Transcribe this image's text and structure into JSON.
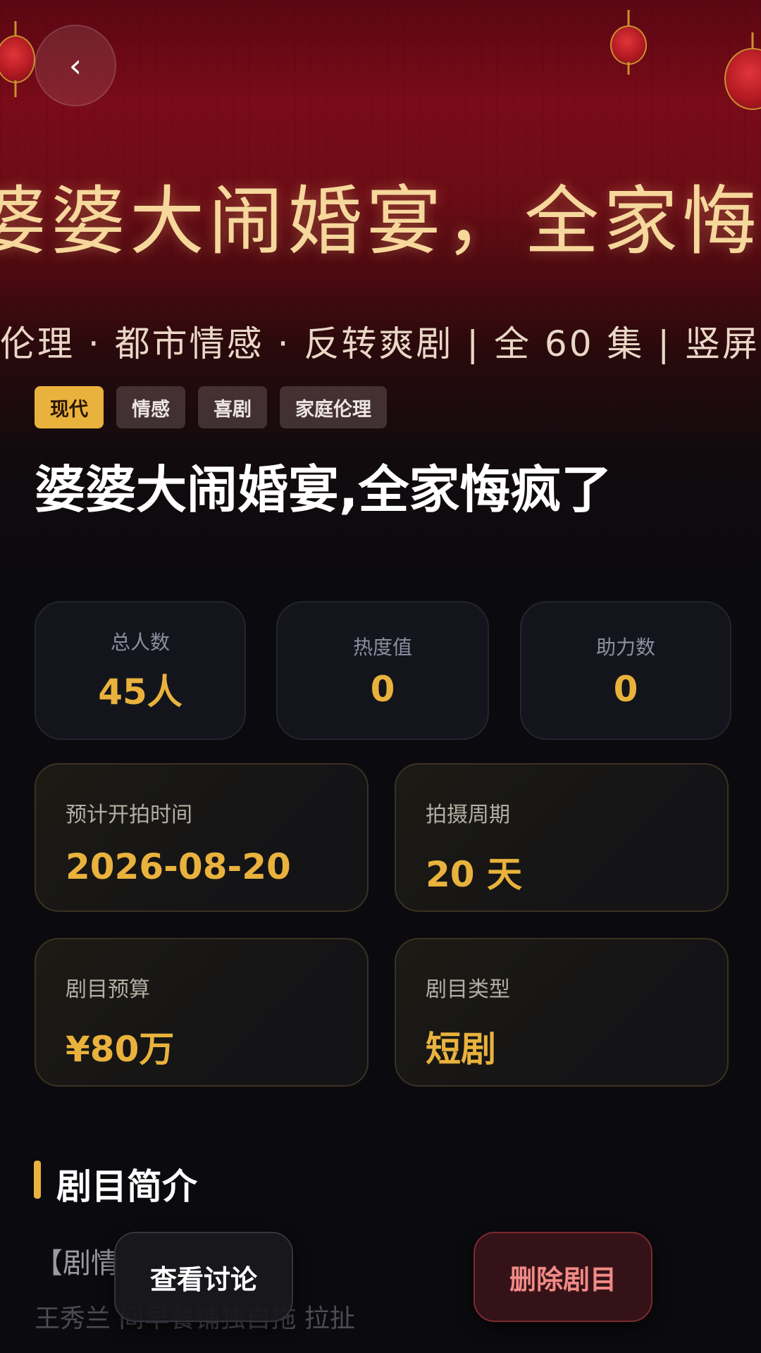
{
  "banner": {
    "title": "婆婆大闹婚宴，全家悔疯了",
    "subtitle": "伦理 ·  都市情感 ·  反转爽剧 | 全 60 集 | 竖屏"
  },
  "nav": {
    "back_icon": "chevron-left-icon",
    "back_glyph": "‹"
  },
  "tags": [
    "现代",
    "情感",
    "喜剧",
    "家庭伦理"
  ],
  "title": "婆婆大闹婚宴,全家悔疯了",
  "stats": [
    {
      "label": "总人数",
      "value": "45人"
    },
    {
      "label": "热度值",
      "value": "0"
    },
    {
      "label": "助力数",
      "value": "0"
    }
  ],
  "info": [
    {
      "label": "预计开拍时间",
      "value": "2026-08-20"
    },
    {
      "label": "拍摄周期",
      "value": "20 天"
    },
    {
      "label": "剧目预算",
      "value": "¥80万"
    },
    {
      "label": "剧目类型",
      "value": "短剧"
    }
  ],
  "synopsis": {
    "heading": "剧目简介",
    "para_head": "【剧情",
    "para_text": "王秀兰               间早餐铺独自拖              拉扯"
  },
  "actions": {
    "discuss": "查看讨论",
    "delete": "删除剧目"
  },
  "colors": {
    "accent": "#e9b23d",
    "danger": "#f08a86",
    "banner_red": "#7a0b18"
  }
}
